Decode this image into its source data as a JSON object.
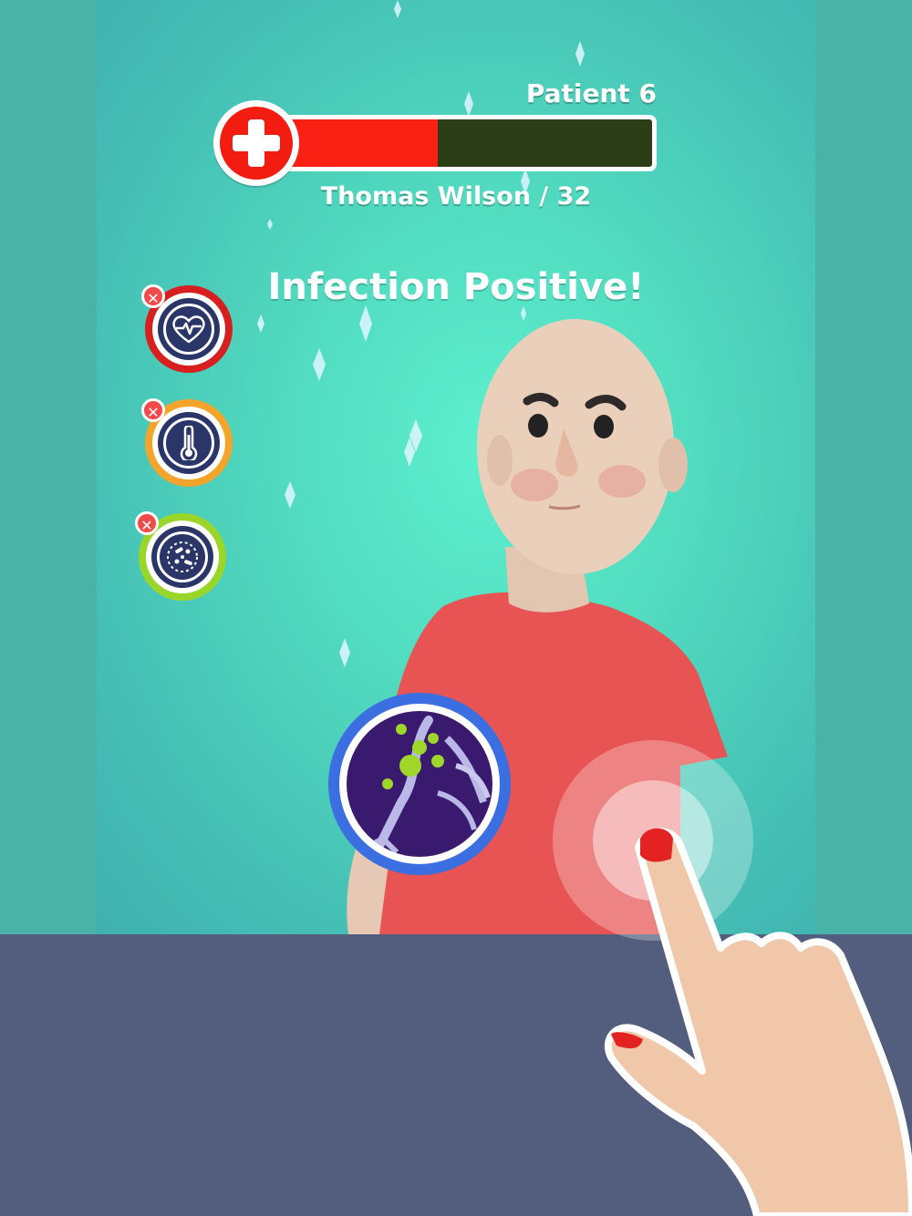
{
  "hud": {
    "patient_label": "Patient 6",
    "patient_name": "Thomas Wilson / 32",
    "health_fraction": 0.44,
    "health_colors": {
      "fill": "#fa2014",
      "empty": "#2d3d17"
    }
  },
  "status_message": "Infection Positive!",
  "tools": [
    {
      "name": "heart-rate",
      "icon": "heartbeat-icon",
      "ring_color": "#d71f1f",
      "used": true
    },
    {
      "name": "thermometer",
      "icon": "thermometer-icon",
      "ring_color": "#f2a52a",
      "used": true
    },
    {
      "name": "microscope",
      "icon": "bacteria-icon",
      "ring_color": "#9ad62a",
      "used": true
    }
  ],
  "scope": {
    "ring_color": "#3b6ee0",
    "view_color": "#3a1a6e"
  },
  "colors": {
    "background": "#55e0c4",
    "counter": "#535d7e"
  }
}
